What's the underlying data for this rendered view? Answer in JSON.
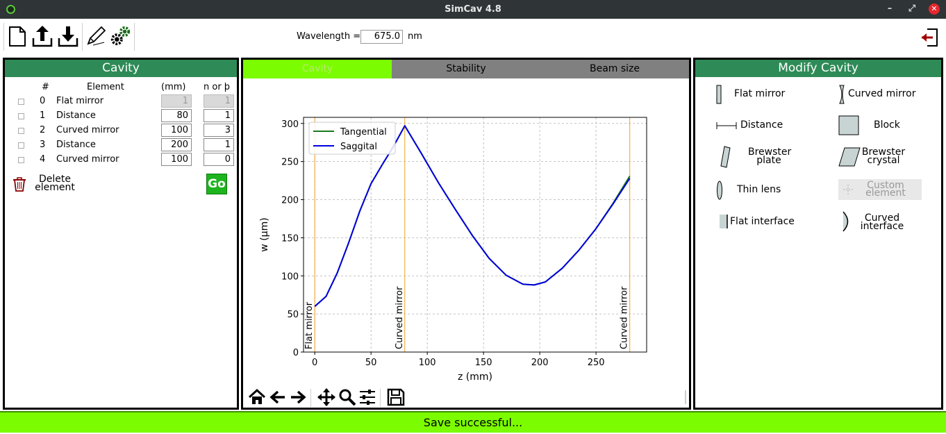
{
  "window": {
    "title": "SimCav 4.8"
  },
  "toolbar": {
    "wavelength_label": "Wavelength =",
    "wavelength_value": "675.0",
    "wavelength_unit": "nm"
  },
  "cavity_panel": {
    "title": "Cavity",
    "columns": [
      "#",
      "Element",
      "(mm)",
      "n or þ"
    ],
    "rows": [
      {
        "num": "0",
        "element": "Flat mirror",
        "mm": "1",
        "n": "1",
        "disabled": true
      },
      {
        "num": "1",
        "element": "Distance",
        "mm": "80",
        "n": "1",
        "disabled": false
      },
      {
        "num": "2",
        "element": "Curved mirror",
        "mm": "100",
        "n": "3",
        "disabled": false
      },
      {
        "num": "3",
        "element": "Distance",
        "mm": "200",
        "n": "1",
        "disabled": false
      },
      {
        "num": "4",
        "element": "Curved mirror",
        "mm": "100",
        "n": "0",
        "disabled": false
      }
    ],
    "delete_label_1": "Delete",
    "delete_label_2": "element",
    "go_label": "Go"
  },
  "plot_panel": {
    "tabs": [
      "Cavity",
      "Stability",
      "Beam size"
    ],
    "active_tab": "Cavity"
  },
  "chart_data": {
    "type": "line",
    "xlabel": "z (mm)",
    "ylabel": "w (µm)",
    "xlim": [
      -10,
      295
    ],
    "ylim": [
      0,
      308
    ],
    "xticks": [
      0,
      50,
      100,
      150,
      200,
      250
    ],
    "yticks": [
      0,
      50,
      100,
      150,
      200,
      250,
      300
    ],
    "grid": true,
    "legend_position": "top-left",
    "series": [
      {
        "name": "Tangential",
        "color": "#1a7a1a",
        "x": [
          0,
          10,
          20,
          30,
          40,
          50,
          60,
          70,
          80,
          95,
          110,
          125,
          140,
          155,
          170,
          185,
          195,
          205,
          220,
          235,
          250,
          265,
          280
        ],
        "y": [
          60,
          73,
          104,
          143,
          185,
          221,
          246,
          270,
          297,
          260,
          222,
          187,
          153,
          123,
          101,
          89,
          88,
          92,
          110,
          134,
          162,
          195,
          231
        ]
      },
      {
        "name": "Saggital",
        "color": "#0000dd",
        "x": [
          0,
          10,
          20,
          30,
          40,
          50,
          60,
          70,
          80,
          95,
          110,
          125,
          140,
          155,
          170,
          185,
          195,
          205,
          220,
          235,
          250,
          265,
          280
        ],
        "y": [
          60,
          73,
          104,
          143,
          185,
          221,
          246,
          270,
          297,
          260,
          222,
          187,
          153,
          123,
          101,
          89,
          88,
          92,
          110,
          134,
          162,
          194,
          228
        ]
      }
    ],
    "markers": [
      {
        "x": 0,
        "label": "Flat mirror"
      },
      {
        "x": 80,
        "label": "Curved mirror"
      },
      {
        "x": 280,
        "label": "Curved mirror"
      }
    ]
  },
  "modify_panel": {
    "title": "Modify Cavity",
    "items": {
      "flat_mirror": "Flat mirror",
      "curved_mirror": "Curved mirror",
      "distance": "Distance",
      "block": "Block",
      "brewster_plate_1": "Brewster",
      "brewster_plate_2": "plate",
      "brewster_crystal_1": "Brewster",
      "brewster_crystal_2": "crystal",
      "thin_lens": "Thin lens",
      "custom_element_1": "Custom",
      "custom_element_2": "element",
      "flat_interface": "Flat interface",
      "curved_interface_1": "Curved",
      "curved_interface_2": "interface"
    }
  },
  "status": {
    "text": "Save successful..."
  }
}
